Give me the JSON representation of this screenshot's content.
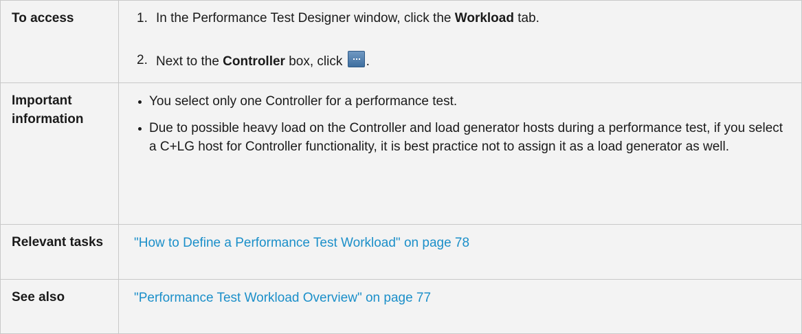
{
  "rows": {
    "access": {
      "label": "To access",
      "steps": [
        {
          "num": "1.",
          "pre": "In the Performance Test Designer window, click the ",
          "bold": "Workload",
          "post": " tab."
        },
        {
          "num": "2.",
          "pre": "Next to the ",
          "bold": "Controller",
          "mid": " box, click ",
          "icon": "ellipsis-button-icon",
          "post": "."
        }
      ]
    },
    "important": {
      "label": "Important information",
      "bullets": [
        "You select only one Controller for a performance test.",
        "Due to possible heavy load on the Controller and load generator hosts during a performance test, if you select a C+LG host for Controller functionality, it is best practice not to assign it as a load generator as well."
      ]
    },
    "tasks": {
      "label": "Relevant tasks",
      "link": "\"How to Define a Performance Test Workload\" on page 78"
    },
    "see_also": {
      "label": "See also",
      "link": "\"Performance Test Workload Overview\" on page 77"
    }
  },
  "colors": {
    "link": "#1b8fc9",
    "cell_background": "#f3f3f3",
    "border": "#c8c8c8",
    "text": "#1a1a1a"
  }
}
